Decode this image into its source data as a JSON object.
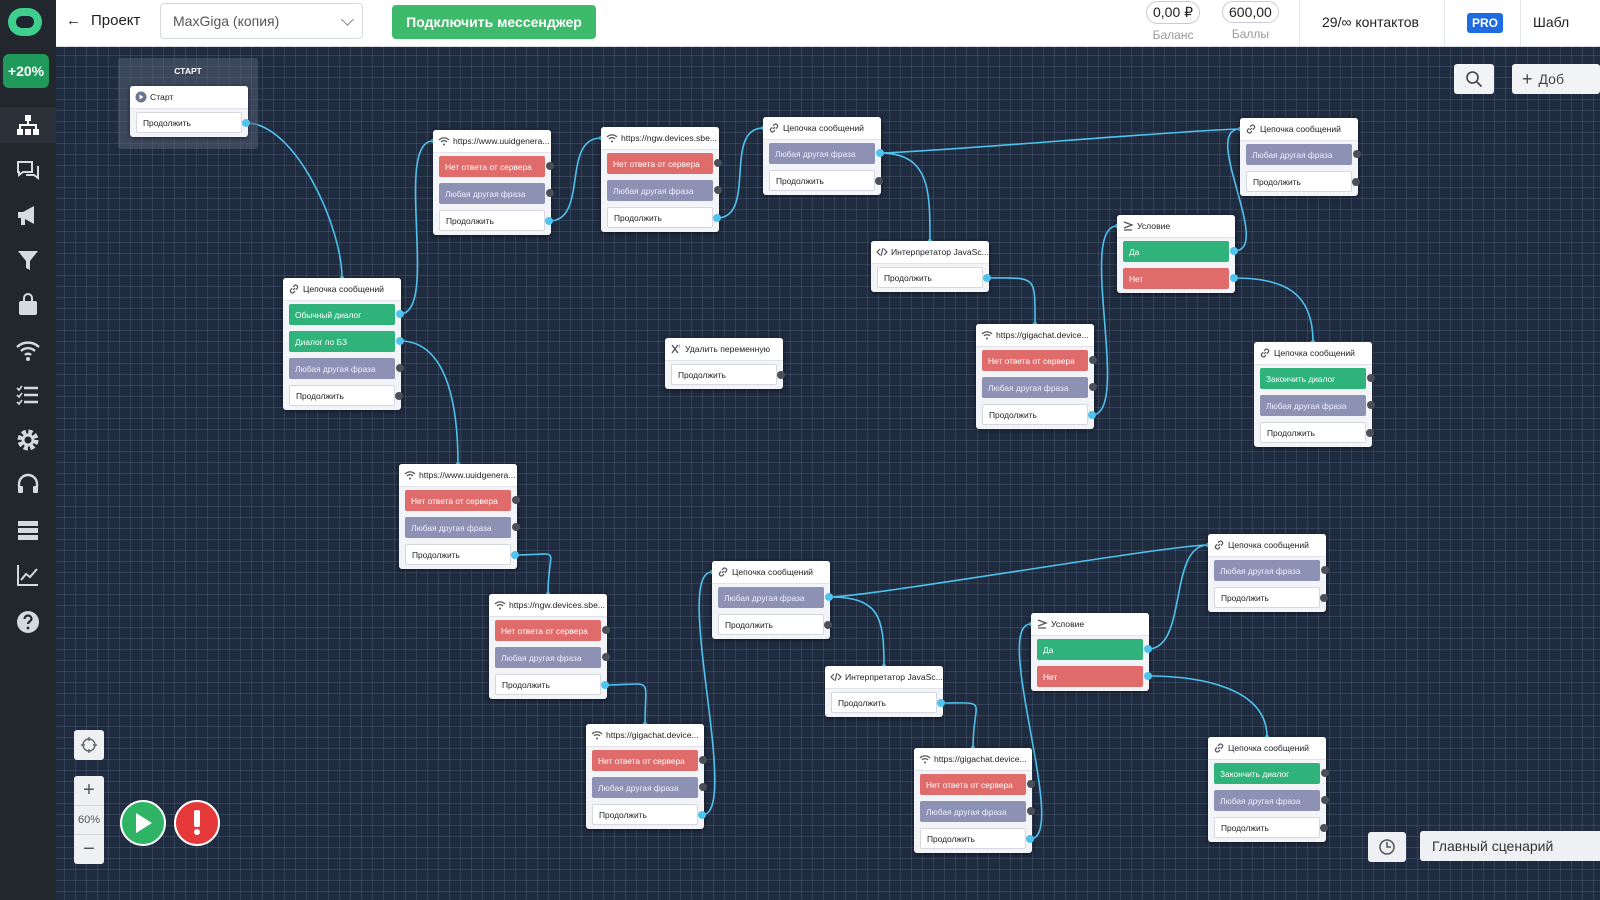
{
  "topbar": {
    "back_label": "Проект",
    "project_select": "MaxGiga (копия)",
    "connect_button": "Подключить мессенджер",
    "balance_value": "0,00 ₽",
    "balance_caption": "Баланс",
    "points_value": "600,00",
    "points_caption": "Баллы",
    "contacts": "29/∞ контактов",
    "plan_badge": "PRO",
    "templates_label": "Шабл"
  },
  "sidebar": {
    "promo": "+20%",
    "items": [
      "scenarios-icon",
      "chats-icon",
      "broadcast-icon",
      "filter-icon",
      "shop-icon",
      "webhook-icon",
      "lists-icon",
      "settings-icon",
      "support-icon",
      "database-icon",
      "analytics-icon",
      "help-icon"
    ]
  },
  "canvas": {
    "start_title": "СТАРТ",
    "zoom_level": "60%",
    "scenario_label": "Главный сценарий",
    "add_button": "Доб"
  },
  "colors": {
    "red": "#e06b6b",
    "gray": "#8d91b3",
    "green": "#30b37a",
    "wire": "#4fc3ee",
    "grid_bg": "#1f2b3f"
  },
  "nodes": [
    {
      "id": "start",
      "icon": "play",
      "title": "Старт",
      "rows": [
        {
          "label": "Продолжить",
          "color": "plain",
          "connected": true
        }
      ]
    },
    {
      "id": "chain1",
      "icon": "link",
      "title": "Цепочка сообщений",
      "rows": [
        {
          "label": "Обычный диалог",
          "color": "green",
          "connected": true
        },
        {
          "label": "Диалог по БЗ",
          "color": "green",
          "connected": true
        },
        {
          "label": "Любая другая фраза",
          "color": "gray",
          "connected": false
        },
        {
          "label": "Продолжить",
          "color": "plain",
          "connected": false
        }
      ]
    },
    {
      "id": "http1",
      "icon": "wifi",
      "title": "https://www.uuidgenera...",
      "rows": [
        {
          "label": "Нет ответа от сервера",
          "color": "red",
          "connected": false
        },
        {
          "label": "Любая другая фраза",
          "color": "gray",
          "connected": false
        },
        {
          "label": "Продолжить",
          "color": "plain",
          "connected": true
        }
      ]
    },
    {
      "id": "http2",
      "icon": "wifi",
      "title": "https://ngw.devices.sbe...",
      "rows": [
        {
          "label": "Нет ответа от сервера",
          "color": "red",
          "connected": false
        },
        {
          "label": "Любая другая фраза",
          "color": "gray",
          "connected": false
        },
        {
          "label": "Продолжить",
          "color": "plain",
          "connected": true
        }
      ]
    },
    {
      "id": "chain2",
      "icon": "link",
      "title": "Цепочка сообщений",
      "rows": [
        {
          "label": "Любая другая фраза",
          "color": "gray",
          "connected": true
        },
        {
          "label": "Продолжить",
          "color": "plain",
          "connected": false
        }
      ]
    },
    {
      "id": "js1",
      "icon": "code",
      "title": "Интерпретатор JavaSc...",
      "rows": [
        {
          "label": "Продолжить",
          "color": "plain",
          "connected": true
        }
      ]
    },
    {
      "id": "chain3",
      "icon": "link",
      "title": "Цепочка сообщений",
      "rows": [
        {
          "label": "Любая другая фраза",
          "color": "gray",
          "connected": false
        },
        {
          "label": "Продолжить",
          "color": "plain",
          "connected": false
        }
      ]
    },
    {
      "id": "cond1",
      "icon": "cond",
      "title": "Условие",
      "rows": [
        {
          "label": "Да",
          "color": "green",
          "connected": true
        },
        {
          "label": "Нет",
          "color": "red",
          "connected": true
        }
      ]
    },
    {
      "id": "delvar",
      "icon": "x",
      "title": "Удалить переменную",
      "rows": [
        {
          "label": "Продолжить",
          "color": "plain",
          "connected": false
        }
      ]
    },
    {
      "id": "giga1",
      "icon": "wifi",
      "title": "https://gigachat.device...",
      "rows": [
        {
          "label": "Нет ответа от сервера",
          "color": "red",
          "connected": false
        },
        {
          "label": "Любая другая фраза",
          "color": "gray",
          "connected": false
        },
        {
          "label": "Продолжить",
          "color": "plain",
          "connected": true
        }
      ]
    },
    {
      "id": "chain4",
      "icon": "link",
      "title": "Цепочка сообщений",
      "rows": [
        {
          "label": "Закончить диалог",
          "color": "green",
          "connected": false
        },
        {
          "label": "Любая другая фраза",
          "color": "gray",
          "connected": false
        },
        {
          "label": "Продолжить",
          "color": "plain",
          "connected": false
        }
      ]
    },
    {
      "id": "http3",
      "icon": "wifi",
      "title": "https://www.uuidgenera...",
      "rows": [
        {
          "label": "Нет ответа от сервера",
          "color": "red",
          "connected": false
        },
        {
          "label": "Любая другая фраза",
          "color": "gray",
          "connected": false
        },
        {
          "label": "Продолжить",
          "color": "plain",
          "connected": true
        }
      ]
    },
    {
      "id": "http4",
      "icon": "wifi",
      "title": "https://ngw.devices.sbe...",
      "rows": [
        {
          "label": "Нет ответа от сервера",
          "color": "red",
          "connected": false
        },
        {
          "label": "Любая другая фраза",
          "color": "gray",
          "connected": false
        },
        {
          "label": "Продолжить",
          "color": "plain",
          "connected": true
        }
      ]
    },
    {
      "id": "chain5",
      "icon": "link",
      "title": "Цепочка сообщений",
      "rows": [
        {
          "label": "Любая другая фраза",
          "color": "gray",
          "connected": true
        },
        {
          "label": "Продолжить",
          "color": "plain",
          "connected": false
        }
      ]
    },
    {
      "id": "giga2",
      "icon": "wifi",
      "title": "https://gigachat.device...",
      "rows": [
        {
          "label": "Нет ответа от сервера",
          "color": "red",
          "connected": false
        },
        {
          "label": "Любая другая фраза",
          "color": "gray",
          "connected": false
        },
        {
          "label": "Продолжить",
          "color": "plain",
          "connected": true
        }
      ]
    },
    {
      "id": "js2",
      "icon": "code",
      "title": "Интерпретатор JavaSc...",
      "rows": [
        {
          "label": "Продолжить",
          "color": "plain",
          "connected": true
        }
      ]
    },
    {
      "id": "giga3",
      "icon": "wifi",
      "title": "https://gigachat.device...",
      "rows": [
        {
          "label": "Нет ответа от сервера",
          "color": "red",
          "connected": false
        },
        {
          "label": "Любая другая фраза",
          "color": "gray",
          "connected": false
        },
        {
          "label": "Продолжить",
          "color": "plain",
          "connected": true
        }
      ]
    },
    {
      "id": "chain6",
      "icon": "link",
      "title": "Цепочка сообщений",
      "rows": [
        {
          "label": "Любая другая фраза",
          "color": "gray",
          "connected": false
        },
        {
          "label": "Продолжить",
          "color": "plain",
          "connected": false
        }
      ]
    },
    {
      "id": "cond2",
      "icon": "cond",
      "title": "Условие",
      "rows": [
        {
          "label": "Да",
          "color": "green",
          "connected": true
        },
        {
          "label": "Нет",
          "color": "red",
          "connected": true
        }
      ]
    },
    {
      "id": "chain7",
      "icon": "link",
      "title": "Цепочка сообщений",
      "rows": [
        {
          "label": "Закончить диалог",
          "color": "green",
          "connected": false
        },
        {
          "label": "Любая другая фраза",
          "color": "gray",
          "connected": false
        },
        {
          "label": "Продолжить",
          "color": "plain",
          "connected": false
        }
      ]
    }
  ],
  "connections": [
    [
      "start",
      0,
      "chain1"
    ],
    [
      "chain1",
      0,
      "http1"
    ],
    [
      "chain1",
      1,
      "http3"
    ],
    [
      "http1",
      2,
      "http2"
    ],
    [
      "http2",
      2,
      "chain2"
    ],
    [
      "chain2",
      0,
      "js1"
    ],
    [
      "chain2",
      0,
      "chain3"
    ],
    [
      "js1",
      0,
      "giga1"
    ],
    [
      "giga1",
      2,
      "cond1"
    ],
    [
      "cond1",
      0,
      "chain3"
    ],
    [
      "cond1",
      1,
      "chain4"
    ],
    [
      "http3",
      2,
      "http4"
    ],
    [
      "http4",
      2,
      "giga2"
    ],
    [
      "giga2",
      2,
      "chain5"
    ],
    [
      "chain5",
      0,
      "js2"
    ],
    [
      "chain5",
      0,
      "chain6"
    ],
    [
      "js2",
      0,
      "giga3"
    ],
    [
      "giga3",
      2,
      "cond2"
    ],
    [
      "cond2",
      0,
      "chain6"
    ],
    [
      "cond2",
      1,
      "chain7"
    ]
  ]
}
